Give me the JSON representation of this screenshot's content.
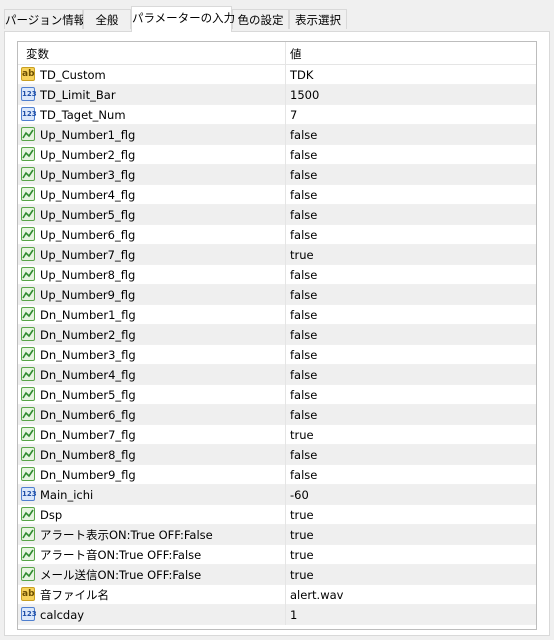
{
  "tabs": [
    {
      "label": "パージョン情報"
    },
    {
      "label": "全般"
    },
    {
      "label": "パラメーターの入力"
    },
    {
      "label": "色の設定"
    },
    {
      "label": "表示選択"
    }
  ],
  "active_tab": 2,
  "grid": {
    "header_variable": "変数",
    "header_value": "値",
    "rows": [
      {
        "icon": "ab-icon",
        "name": "TD_Custom",
        "value": "TDK"
      },
      {
        "icon": "numeric-icon",
        "name": "TD_Limit_Bar",
        "value": "1500"
      },
      {
        "icon": "numeric-icon",
        "name": "TD_Taget_Num",
        "value": "7"
      },
      {
        "icon": "boolean-icon",
        "name": "Up_Number1_flg",
        "value": "false"
      },
      {
        "icon": "boolean-icon",
        "name": "Up_Number2_flg",
        "value": "false"
      },
      {
        "icon": "boolean-icon",
        "name": "Up_Number3_flg",
        "value": "false"
      },
      {
        "icon": "boolean-icon",
        "name": "Up_Number4_flg",
        "value": "false"
      },
      {
        "icon": "boolean-icon",
        "name": "Up_Number5_flg",
        "value": "false"
      },
      {
        "icon": "boolean-icon",
        "name": "Up_Number6_flg",
        "value": "false"
      },
      {
        "icon": "boolean-icon",
        "name": "Up_Number7_flg",
        "value": "true"
      },
      {
        "icon": "boolean-icon",
        "name": "Up_Number8_flg",
        "value": "false"
      },
      {
        "icon": "boolean-icon",
        "name": "Up_Number9_flg",
        "value": "false"
      },
      {
        "icon": "boolean-icon",
        "name": "Dn_Number1_flg",
        "value": "false"
      },
      {
        "icon": "boolean-icon",
        "name": "Dn_Number2_flg",
        "value": "false"
      },
      {
        "icon": "boolean-icon",
        "name": "Dn_Number3_flg",
        "value": "false"
      },
      {
        "icon": "boolean-icon",
        "name": "Dn_Number4_flg",
        "value": "false"
      },
      {
        "icon": "boolean-icon",
        "name": "Dn_Number5_flg",
        "value": "false"
      },
      {
        "icon": "boolean-icon",
        "name": "Dn_Number6_flg",
        "value": "false"
      },
      {
        "icon": "boolean-icon",
        "name": "Dn_Number7_flg",
        "value": "true"
      },
      {
        "icon": "boolean-icon",
        "name": "Dn_Number8_flg",
        "value": "false"
      },
      {
        "icon": "boolean-icon",
        "name": "Dn_Number9_flg",
        "value": "false"
      },
      {
        "icon": "numeric-icon",
        "name": "Main_ichi",
        "value": "-60"
      },
      {
        "icon": "boolean-icon",
        "name": "Dsp",
        "value": "true"
      },
      {
        "icon": "boolean-icon",
        "name": "アラート表示ON:True OFF:False",
        "value": "true"
      },
      {
        "icon": "boolean-icon",
        "name": "アラート音ON:True OFF:False",
        "value": "true"
      },
      {
        "icon": "boolean-icon",
        "name": "メール送信ON:True OFF:False",
        "value": "true"
      },
      {
        "icon": "ab-icon",
        "name": "音ファイル名",
        "value": "alert.wav"
      },
      {
        "icon": "numeric-icon",
        "name": "calcday",
        "value": "1"
      }
    ]
  }
}
